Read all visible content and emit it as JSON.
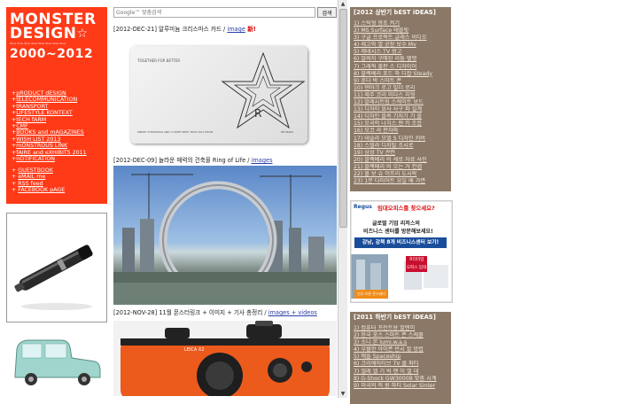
{
  "logo": {
    "line1": "MONSTER",
    "line2": "DESIGN",
    "tagline": "Wow  Wow  Wow  Wow  Wow  Wow  Wow  Wow",
    "years": "2000~2012"
  },
  "menu": [
    "pRODUCT dESIGN",
    "tELECOMMUNICATION",
    "tRANSPORT",
    "LIFESTYLE KONTEXT",
    "tECH fARM",
    "CMF",
    "BOOKS and mAGAZINES",
    "WISH LIST 2013",
    "mONSTROUS LINK",
    "fAIRE and eXHIBITS 2011",
    "nOTIFICATION"
  ],
  "menu2": [
    "GUESTBOOK",
    "eMAIL me",
    "RSS feed",
    "FACEBOOK pAGE"
  ],
  "search": {
    "placeholder": "Google™ 맞춤검색",
    "button": "검색"
  },
  "posts": [
    {
      "date": "[2012-DEC-21]",
      "title": " 알루미늄 크리스마스 카드 / ",
      "link": "image",
      "badge": " 新!"
    },
    {
      "date": "[2012-DEC-09]",
      "title": " 놀라운 매력의 건축물 Ring of Life / ",
      "link": "images"
    },
    {
      "date": "[2012-NOV-28]",
      "title": " 11월 몬스터링크 + 이미지 + 기사 총정리 / ",
      "link": "images + videos"
    }
  ],
  "card": {
    "headline": "TOGETHER FOR BETTER",
    "footer": "MERRY CHRISTMAS AND A HAPPY NEW YEAR 2013 FROM",
    "brand": "REYNARS"
  },
  "camera_brand": "LEICA X2",
  "top2012": {
    "title": "[2012 상반기 bEST iDEAS]",
    "items": [
      "1) 스틱형 향초 켜기",
      "2) MS Surface 태블릿",
      "3) 구글 프로젝트 글래스 비디오",
      "4) 레고와 멸 공장 보수 Mv",
      "5) 제네시스 TV 광고",
      "6) 알려지 구매된 리튬 헬멧",
      "7) 그래픽 출판 스 디자이어",
      "8) 블랙베리 포드 와 디잡 Steady",
      "9) 혼다 박 스마트 폰",
      "10) 덴마크 로고 빌더 로리",
      "11) 제주 코리 미다스 지형",
      "12) 말레시트링 스케이트 보드",
      "13) 디자이 회사 사구 파 설계",
      "14) 디자인 블록 기지기 기 블",
      "15) 모국의 나치스 렌 키 조합",
      "16) 모코 라 판자와",
      "17) 테슬라 모델 S 디자인 커버",
      "18) 스텔라 디지털 조시로",
      "19) 삼성 TV 관련",
      "20) 블랙베리 비 세로 자료 사진",
      "21) 블랙베리 비 오는 거 컨셉",
      "22) 볼 보 슈 이프리 도시락",
      "23) 1분 다이어트 요일 배 가면"
    ]
  },
  "ad": {
    "brand": "Regus",
    "headline": "임대오피스를 찾으세요?",
    "line1": "글로벌 기업 리저스의",
    "line2": "비즈니스 센터를 방문해보세요!",
    "line3": "강남, 강북 8개 비즈니스센터 보기!",
    "cta1": "프리미엄",
    "cta2": "오피스 임대",
    "footer": "신규 오픈 몬스센터"
  },
  "top2011": {
    "title": "[2011 하반기 bEST iDEAS]",
    "items": [
      "1) 컴퓨터 프린트용 할렌이",
      "2) 한국 포스 스마트 폰 스케줄",
      "3) 소니 본 lumi.w.a.s",
      "4) 우월한 아이폰 반시 할 방법",
      "5) 애플 Spaceship",
      "6) 크리에이티브 TV 롤 파티",
      "7) 엘레 엘 기 빅 맨 이 엘 대",
      "8) G-Shock GW3000B 맞춤 시계",
      "9) 미국의 의 원 파티 Solar Sinter"
    ]
  },
  "colors": {
    "left_panel": "#ff3a17",
    "right_panel": "#8b7866",
    "link": "#2b3fa8"
  }
}
